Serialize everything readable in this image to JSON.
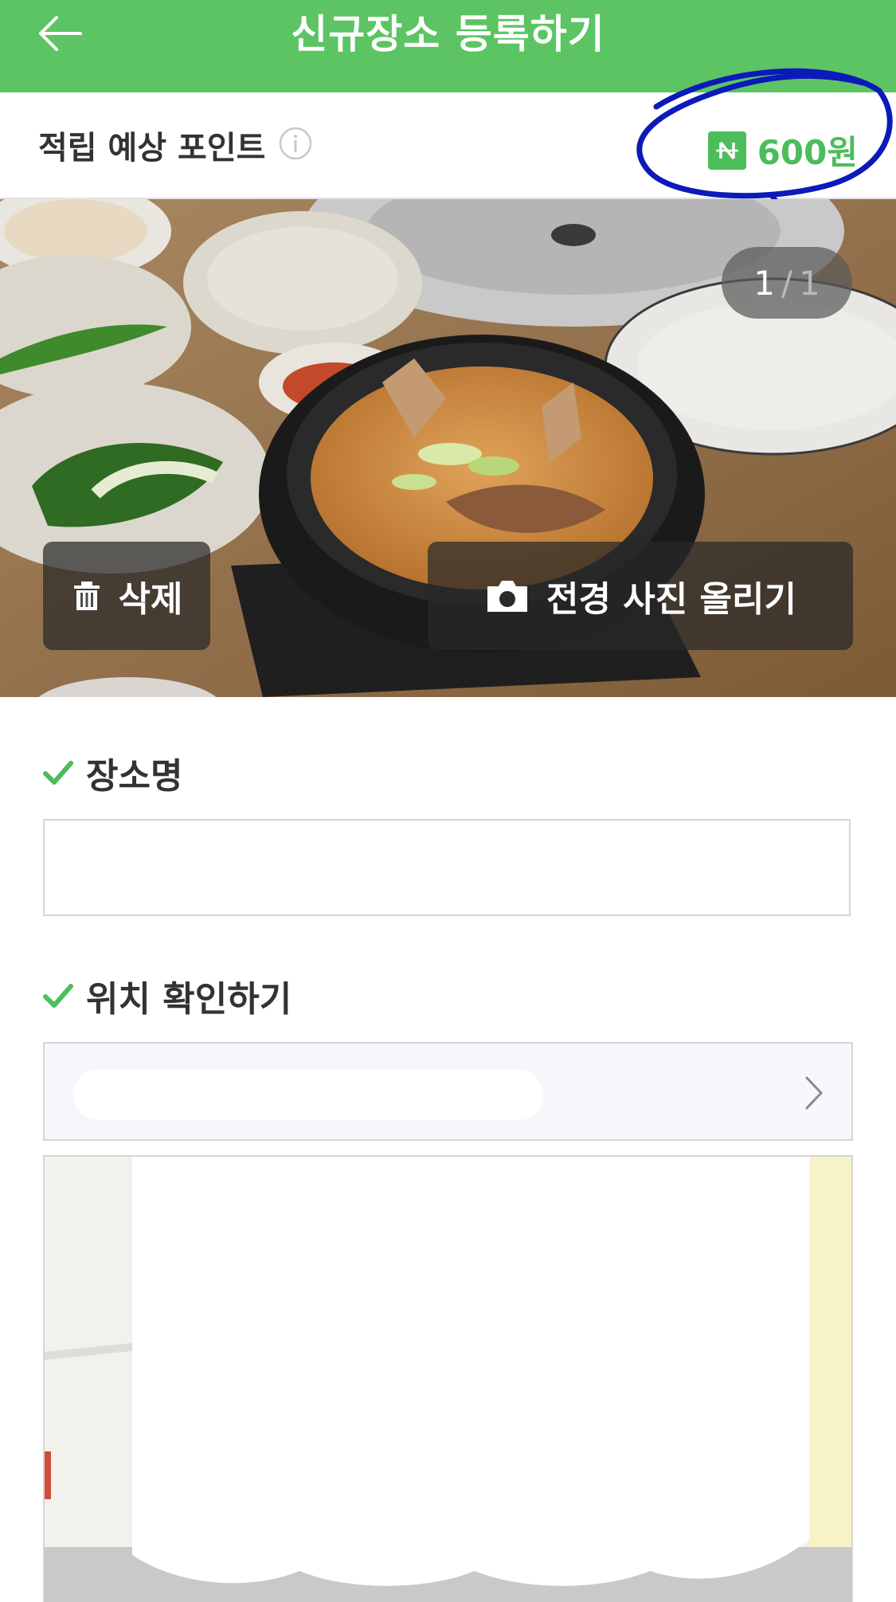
{
  "header": {
    "title": "신규장소 등록하기",
    "back_icon": "arrow-left-icon",
    "background": "#5cc463"
  },
  "points": {
    "label": "적립 예상 포인트",
    "info_icon": "info-icon",
    "currency_icon": "naver-n-icon",
    "amount": "600원",
    "accent": "#4cbd5a"
  },
  "photo": {
    "current": "1",
    "separator": "/",
    "total": "1",
    "delete_label": "삭제",
    "delete_icon": "trash-icon",
    "upload_label": "전경 사진 올리기",
    "upload_icon": "camera-icon"
  },
  "form": {
    "name_label": "장소명",
    "name_value": "",
    "location_label": "위치 확인하기",
    "check_icon": "checkmark-icon",
    "chevron_icon": "chevron-right-icon"
  }
}
